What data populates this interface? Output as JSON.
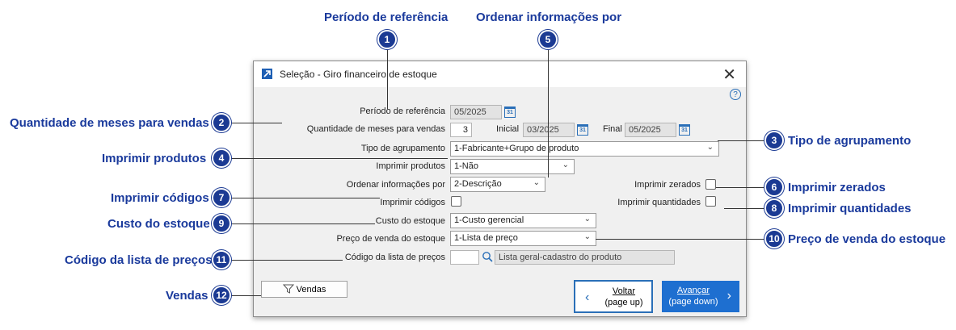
{
  "annotations": [
    {
      "n": "1",
      "label": "Período de referência"
    },
    {
      "n": "2",
      "label": "Quantidade de meses para vendas"
    },
    {
      "n": "3",
      "label": "Tipo de agrupamento"
    },
    {
      "n": "4",
      "label": "Imprimir produtos"
    },
    {
      "n": "5",
      "label": "Ordenar informações por"
    },
    {
      "n": "6",
      "label": "Imprimir zerados"
    },
    {
      "n": "7",
      "label": "Imprimir códigos"
    },
    {
      "n": "8",
      "label": "Imprimir quantidades"
    },
    {
      "n": "9",
      "label": "Custo do estoque"
    },
    {
      "n": "10",
      "label": "Preço de venda do estoque"
    },
    {
      "n": "11",
      "label": "Código da lista de preços"
    },
    {
      "n": "12",
      "label": "Vendas"
    }
  ],
  "dialog": {
    "title": "Seleção - Giro financeiro de estoque",
    "close": "✕",
    "help": "?"
  },
  "form": {
    "periodo_label": "Período de referência",
    "periodo_value": "05/2025",
    "qtd_meses_label": "Quantidade de meses para vendas",
    "qtd_meses_value": "3",
    "inicial_label": "Inicial",
    "inicial_value": "03/2025",
    "final_label": "Final",
    "final_value": "05/2025",
    "agrupamento_label": "Tipo de agrupamento",
    "agrupamento_value": "1-Fabricante+Grupo de produto",
    "imprimir_produtos_label": "Imprimir produtos",
    "imprimir_produtos_value": "1-Não",
    "ordenar_label": "Ordenar informações por",
    "ordenar_value": "2-Descrição",
    "imprimir_zerados_label": "Imprimir zerados",
    "imprimir_codigos_label": "Imprimir códigos",
    "imprimir_quantidades_label": "Imprimir quantidades",
    "custo_label": "Custo do estoque",
    "custo_value": "1-Custo gerencial",
    "preco_label": "Preço de venda do estoque",
    "preco_value": "1-Lista de preço",
    "codigo_lista_label": "Código da lista de preços",
    "codigo_lista_value": "",
    "lista_descricao": "Lista geral-cadastro do produto"
  },
  "buttons": {
    "vendas": "Vendas",
    "voltar_line1": "Voltar",
    "voltar_line2": "(page up)",
    "avancar_line1": "Avançar",
    "avancar_line2": "(page down)"
  },
  "colors": {
    "annotation": "#1a3a9c",
    "badge": "#1b3a93",
    "primary_button": "#1e6fd0"
  }
}
